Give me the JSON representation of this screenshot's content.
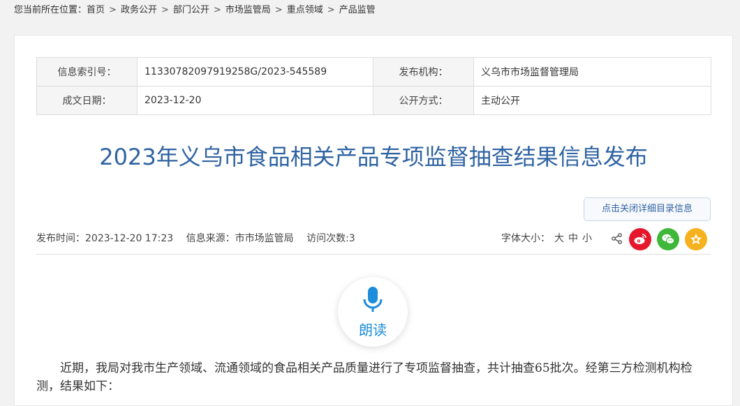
{
  "breadcrumb": {
    "prefix": "您当前所在位置：",
    "items": [
      "首页",
      "政务公开",
      "部门公开",
      "市场监管局",
      "重点领域",
      "产品监管"
    ],
    "separator": ">"
  },
  "meta": {
    "index_label": "信息索引号：",
    "index_value": "11330782097919258G/2023-545589",
    "org_label": "发布机构：",
    "org_value": "义乌市市场监督管理局",
    "date_label": "成文日期：",
    "date_value": "2023-12-20",
    "method_label": "公开方式：",
    "method_value": "主动公开"
  },
  "article": {
    "title": "2023年义乌市食品相关产品专项监督抽查结果信息发布",
    "toggle_label": "点击关闭详细目录信息",
    "publish_time": "发布时间：2023-12-20 17:23",
    "source": "信息来源：市市场监管局",
    "visits": "访问次数:3",
    "fontsize_label": "字体大小：",
    "fontsize_large": "大",
    "fontsize_medium": "中",
    "fontsize_small": "小",
    "listen_label": "朗读",
    "body": "近期，我局对我市生产领域、流通领域的食品相关产品质量进行了专项监督抽查，共计抽查65批次。经第三方检测机构检测，结果如下："
  },
  "icons": {
    "share": "share-icon",
    "weibo": "weibo-icon",
    "wechat": "wechat-icon",
    "favorite": "star-icon",
    "listen": "microphone-icon"
  },
  "colors": {
    "title": "#2f63a2",
    "weibo": "#e6162d",
    "wechat": "#3fb83a",
    "favorite": "#f5b11e",
    "listen": "#1c8cdc"
  }
}
